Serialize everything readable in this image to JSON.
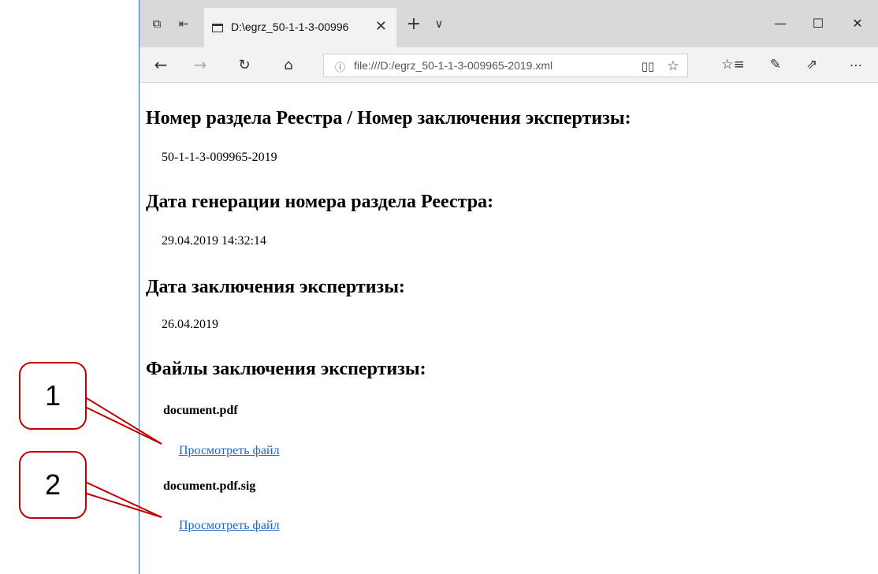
{
  "browser": {
    "tab_title": "D:\\egrz_50-1-1-3-00996",
    "url": "file:///D:/egrz_50-1-1-3-009965-2019.xml",
    "accent_color": "#2b6cc4",
    "icons": {
      "tab_actions": "tabs-aside-icon",
      "set_aside": "set-aside-icon",
      "tab_page": "page-icon",
      "tab_close": "close-icon",
      "new_tab": "plus-icon",
      "tab_list": "chevron-down-icon",
      "minimize": "minimize-icon",
      "maximize": "maximize-icon",
      "close": "close-icon",
      "back": "back-arrow-icon",
      "forward": "forward-arrow-icon",
      "refresh": "refresh-icon",
      "home": "home-icon",
      "site_info": "info-icon",
      "reading_view": "reading-view-icon",
      "favorite": "star-icon",
      "favorites_hub": "favorites-icon",
      "notes": "pen-icon",
      "share": "share-icon",
      "more": "more-icon"
    }
  },
  "document": {
    "sections": [
      {
        "heading": "Номер раздела Реестра / Номер заключения экспертизы:",
        "value": "50-1-1-3-009965-2019"
      },
      {
        "heading": "Дата генерации номера раздела Реестра:",
        "value": "29.04.2019 14:32:14"
      },
      {
        "heading": "Дата заключения экспертизы:",
        "value": "26.04.2019"
      }
    ],
    "files_heading": "Файлы заключения экспертизы:",
    "files": [
      {
        "name": "document.pdf",
        "link_text": "Просмотреть файл"
      },
      {
        "name": "document.pdf.sig",
        "link_text": "Просмотреть файл"
      }
    ],
    "link_color": "#1b66c9"
  },
  "callouts": [
    {
      "label": "1",
      "color": "#c00000"
    },
    {
      "label": "2",
      "color": "#c00000"
    }
  ]
}
